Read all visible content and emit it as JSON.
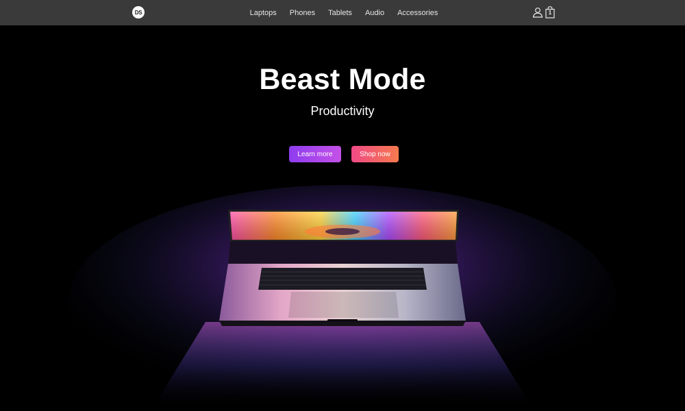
{
  "brand": {
    "logo_text": "DS"
  },
  "nav": {
    "links": [
      "Laptops",
      "Phones",
      "Tablets",
      "Audio",
      "Accessories"
    ],
    "cart_count": "1"
  },
  "hero": {
    "title": "Beast Mode",
    "subtitle": "Productivity",
    "learn_more_label": "Learn more",
    "shop_now_label": "Shop now"
  },
  "colors": {
    "nav_background": "#3a3a3a",
    "page_background": "#000000",
    "learn_more_gradient": [
      "#8e3cf0",
      "#c451e6"
    ],
    "shop_now_gradient": [
      "#f04a86",
      "#f57a4e"
    ]
  },
  "icons": {
    "account": "user-icon",
    "cart": "shopping-bag-icon"
  }
}
